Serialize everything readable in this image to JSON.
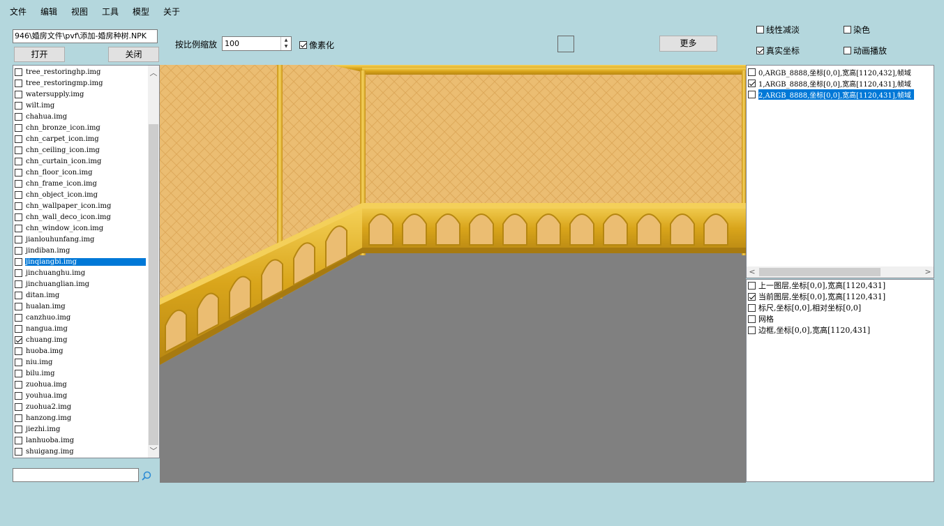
{
  "menu": [
    "文件",
    "编辑",
    "视图",
    "工具",
    "模型",
    "关于"
  ],
  "toolbar": {
    "path_value": "946\\婚房文件\\pvf\\添加-婚房种树.NPK",
    "open_label": "打开",
    "close_label": "关闭",
    "scale_label": "按比例缩放",
    "scale_value": "100",
    "pixelate_label": "像素化",
    "pixelate_checked": true,
    "more_label": "更多",
    "linear_fade_label": "线性减淡",
    "dye_label": "染色",
    "real_coords_label": "真实坐标",
    "animation_label": "动画播放"
  },
  "files": [
    {
      "name": "tree_restoringhp.img",
      "checked": false
    },
    {
      "name": "tree_restoringmp.img",
      "checked": false
    },
    {
      "name": "watersupply.img",
      "checked": false
    },
    {
      "name": "wilt.img",
      "checked": false
    },
    {
      "name": "chahua.img",
      "checked": false
    },
    {
      "name": "chn_bronze_icon.img",
      "checked": false
    },
    {
      "name": "chn_carpet_icon.img",
      "checked": false
    },
    {
      "name": "chn_ceiling_icon.img",
      "checked": false
    },
    {
      "name": "chn_curtain_icon.img",
      "checked": false
    },
    {
      "name": "chn_floor_icon.img",
      "checked": false
    },
    {
      "name": "chn_frame_icon.img",
      "checked": false
    },
    {
      "name": "chn_object_icon.img",
      "checked": false
    },
    {
      "name": "chn_wallpaper_icon.img",
      "checked": false
    },
    {
      "name": "chn_wall_deco_icon.img",
      "checked": false
    },
    {
      "name": "chn_window_icon.img",
      "checked": false
    },
    {
      "name": "jianlouhunfang.img",
      "checked": false
    },
    {
      "name": "jindiban.img",
      "checked": false
    },
    {
      "name": "jinqiangbi.img",
      "checked": false,
      "selected": true
    },
    {
      "name": "jinchuanghu.img",
      "checked": false
    },
    {
      "name": "jinchuanglian.img",
      "checked": false
    },
    {
      "name": "ditan.img",
      "checked": false
    },
    {
      "name": "hualan.img",
      "checked": false
    },
    {
      "name": "canzhuo.img",
      "checked": false
    },
    {
      "name": "nangua.img",
      "checked": false
    },
    {
      "name": "chuang.img",
      "checked": true
    },
    {
      "name": "huoba.img",
      "checked": false
    },
    {
      "name": "niu.img",
      "checked": false
    },
    {
      "name": "bilu.img",
      "checked": false
    },
    {
      "name": "zuohua.img",
      "checked": false
    },
    {
      "name": "youhua.img",
      "checked": false
    },
    {
      "name": "zuohua2.img",
      "checked": false
    },
    {
      "name": "hanzong.img",
      "checked": false
    },
    {
      "name": "jiezhi.img",
      "checked": false
    },
    {
      "name": "lanhuoba.img",
      "checked": false
    },
    {
      "name": "shuigang.img",
      "checked": false
    }
  ],
  "layers": [
    {
      "text": "0,ARGB_8888,坐标[0,0],宽高[1120,432],帧域",
      "checked": false
    },
    {
      "text": "1,ARGB_8888,坐标[0,0],宽高[1120,431],帧域",
      "checked": true
    },
    {
      "text": "2,ARGB_8888,坐标[0,0],宽高[1120,431],帧域",
      "checked": false,
      "selected": true
    }
  ],
  "info": [
    {
      "text": "上一图层,坐标[0,0],宽高[1120,431]",
      "checked": false
    },
    {
      "text": "当前图层,坐标[0,0],宽高[1120,431]",
      "checked": true
    },
    {
      "text": "标尺,坐标[0,0],相对坐标[0,0]",
      "checked": false
    },
    {
      "text": "网格",
      "checked": false
    },
    {
      "text": "边框,坐标[0,0],宽高[1120,431]",
      "checked": false
    }
  ],
  "colors": {
    "background": "#b4d7dd",
    "selection": "#0078d7",
    "wall": "#e8b86a",
    "gold": "#d4a017",
    "floor": "#808080"
  }
}
